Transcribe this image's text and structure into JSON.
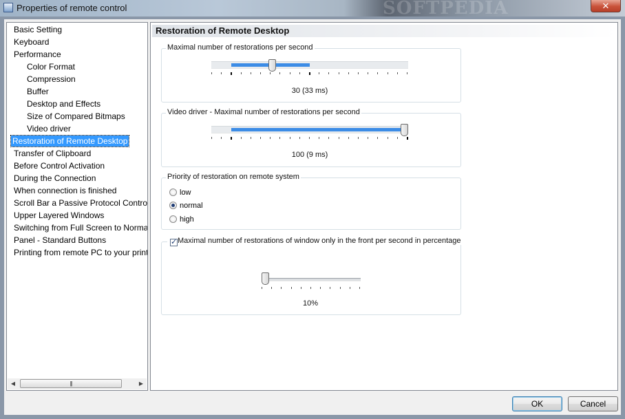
{
  "window": {
    "title": "Properties of remote control",
    "watermark": "SOFTPEDIA",
    "close_label": "✕"
  },
  "tree": {
    "items": [
      {
        "label": "Basic Setting",
        "level": 0,
        "selected": false
      },
      {
        "label": "Keyboard",
        "level": 0,
        "selected": false
      },
      {
        "label": "Performance",
        "level": 0,
        "selected": false
      },
      {
        "label": "Color Format",
        "level": 1,
        "selected": false
      },
      {
        "label": "Compression",
        "level": 1,
        "selected": false
      },
      {
        "label": "Buffer",
        "level": 1,
        "selected": false
      },
      {
        "label": "Desktop and Effects",
        "level": 1,
        "selected": false
      },
      {
        "label": "Size of Compared Bitmaps",
        "level": 1,
        "selected": false
      },
      {
        "label": "Video driver",
        "level": 1,
        "selected": false
      },
      {
        "label": "Restoration of Remote Desktop",
        "level": 0,
        "selected": true
      },
      {
        "label": "Transfer of Clipboard",
        "level": 0,
        "selected": false
      },
      {
        "label": "Before Control Activation",
        "level": 0,
        "selected": false
      },
      {
        "label": "During the Connection",
        "level": 0,
        "selected": false
      },
      {
        "label": "When connection is finished",
        "level": 0,
        "selected": false
      },
      {
        "label": "Scroll Bar a Passive Protocol Control",
        "level": 0,
        "selected": false
      },
      {
        "label": "Upper Layered Windows",
        "level": 0,
        "selected": false
      },
      {
        "label": "Switching from Full Screen to Normal",
        "level": 0,
        "selected": false
      },
      {
        "label": "Panel - Standard Buttons",
        "level": 0,
        "selected": false
      },
      {
        "label": "Printing from remote PC to your printer",
        "level": 0,
        "selected": false
      }
    ],
    "scroll_left_icon": "◀",
    "scroll_right_icon": "▶",
    "scroll_grip": "|||"
  },
  "panel": {
    "title": "Restoration of Remote Desktop",
    "max_restorations": {
      "label": "Maximal number of restorations per second",
      "value_text": "30 (33 ms)",
      "position": 0.3,
      "fill_from": 0.1,
      "fill_to": 0.5
    },
    "video_driver": {
      "label": "Video driver - Maximal number of restorations per second",
      "value_text": "100 (9 ms)",
      "position": 1.0,
      "fill_from": 0.1,
      "fill_to": 1.0
    },
    "priority": {
      "label": "Priority of restoration on remote system",
      "options": [
        "low",
        "normal",
        "high"
      ],
      "selected": "normal"
    },
    "front_window": {
      "label": "Maximal number of restorations of window only in the front per second in percentage",
      "checked": true,
      "check_mark": "✓",
      "value_text": "10%",
      "position": 0.0
    }
  },
  "buttons": {
    "ok": "OK",
    "cancel": "Cancel"
  },
  "colors": {
    "selection": "#3399ff",
    "slider_fill": "#3c8ce6"
  }
}
